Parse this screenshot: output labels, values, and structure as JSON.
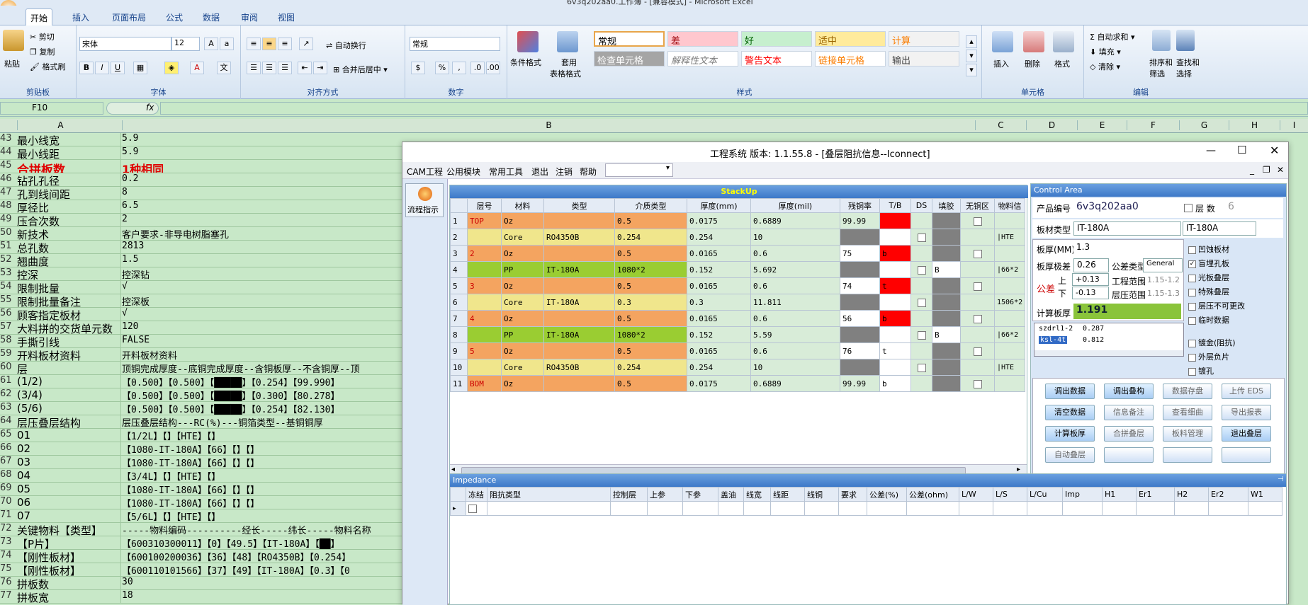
{
  "window_title": "6v3q202aa0.工作簿 - [兼容模式] - Microsoft Excel",
  "ribbon": {
    "tabs": [
      "开始",
      "插入",
      "页面布局",
      "公式",
      "数据",
      "审阅",
      "视图"
    ],
    "clipboard": {
      "paste": "粘贴",
      "cut": "剪切",
      "copy": "复制",
      "format_painter": "格式刷",
      "group": "剪贴板"
    },
    "font": {
      "name": "宋体",
      "size": "12",
      "group": "字体"
    },
    "alignment": {
      "wrap": "自动换行",
      "merge": "合并后居中",
      "group": "对齐方式"
    },
    "number": {
      "format": "常规",
      "group": "数字"
    },
    "styles": {
      "cond_format": "条件格式",
      "table_format_1": "套用",
      "table_format_2": "表格格式",
      "cells": [
        {
          "label": "常规",
          "bg": "#ffffff",
          "fg": "#000000"
        },
        {
          "label": "差",
          "bg": "#ffc7ce",
          "fg": "#9c0006"
        },
        {
          "label": "好",
          "bg": "#c6efce",
          "fg": "#006100"
        },
        {
          "label": "适中",
          "bg": "#ffeb9c",
          "fg": "#9c6500"
        },
        {
          "label": "计算",
          "bg": "#f2f2f2",
          "fg": "#fa7d00"
        },
        {
          "label": "检查单元格",
          "bg": "#a5a5a5",
          "fg": "#ffffff"
        },
        {
          "label": "解释性文本",
          "bg": "#ffffff",
          "fg": "#7f7f7f"
        },
        {
          "label": "警告文本",
          "bg": "#ffffff",
          "fg": "#ff0000"
        },
        {
          "label": "链接单元格",
          "bg": "#ffffff",
          "fg": "#fa7d00"
        },
        {
          "label": "输出",
          "bg": "#f2f2f2",
          "fg": "#3f3f3f"
        }
      ],
      "group": "样式"
    },
    "cells_group": {
      "insert": "插入",
      "delete": "删除",
      "format": "格式",
      "group": "单元格"
    },
    "editing": {
      "autosum": "自动求和",
      "fill": "填充",
      "clear": "清除",
      "sort_1": "排序和",
      "sort_2": "筛选",
      "find_1": "查找和",
      "find_2": "选择",
      "group": "编辑"
    }
  },
  "formula_bar": {
    "name_box": "F10",
    "fx": "fx",
    "value": ""
  },
  "columns": [
    "A",
    "B",
    "C",
    "D",
    "E",
    "F",
    "G",
    "H",
    "I"
  ],
  "rows": [
    {
      "n": "43",
      "a": "最小线宽",
      "b": "5.9"
    },
    {
      "n": "44",
      "a": "最小线距",
      "b": "5.9"
    },
    {
      "n": "45",
      "a": "合拼板数",
      "b": "1种相同",
      "red": true
    },
    {
      "n": "46",
      "a": "钻孔孔径",
      "b": "0.2"
    },
    {
      "n": "47",
      "a": "孔到线间距",
      "b": "8"
    },
    {
      "n": "48",
      "a": "厚径比",
      "b": "6.5"
    },
    {
      "n": "49",
      "a": "压合次数",
      "b": "2"
    },
    {
      "n": "50",
      "a": "新技术",
      "b": "客户要求-非导电树脂塞孔"
    },
    {
      "n": "51",
      "a": "总孔数",
      "b": "2813"
    },
    {
      "n": "52",
      "a": "翘曲度",
      "b": "1.5"
    },
    {
      "n": "53",
      "a": "控深",
      "b": "控深钻"
    },
    {
      "n": "54",
      "a": "限制批量",
      "b": "√"
    },
    {
      "n": "55",
      "a": "限制批量备注",
      "b": "控深板"
    },
    {
      "n": "56",
      "a": "顾客指定板材",
      "b": "√"
    },
    {
      "n": "57",
      "a": "大料拼的交货单元数",
      "b": "120"
    },
    {
      "n": "58",
      "a": "手撕引线",
      "b": "FALSE"
    },
    {
      "n": "59",
      "a": "开料板材资料",
      "b": "开料板材资料"
    },
    {
      "n": "60",
      "a": "层",
      "b": "顶铜完成厚度--底铜完成厚度--含铜板厚--不含铜厚--顶"
    },
    {
      "n": "61",
      "a": "(1/2)",
      "b": "【0.500】【0.500】【█████】【0.254】【99.990】"
    },
    {
      "n": "62",
      "a": "(3/4)",
      "b": "【0.500】【0.500】【█████】【0.300】【80.278】"
    },
    {
      "n": "63",
      "a": "(5/6)",
      "b": "【0.500】【0.500】【█████】【0.254】【82.130】"
    },
    {
      "n": "64",
      "a": "层压叠层结构",
      "b": "层压叠层结构---RC(%)---铜箔类型--基铜铜厚"
    },
    {
      "n": "65",
      "a": "01",
      "b": "【1/2L】【】【HTE】【】"
    },
    {
      "n": "66",
      "a": "02",
      "b": "【1080-IT-180A】【66】【】【】"
    },
    {
      "n": "67",
      "a": "03",
      "b": "【1080-IT-180A】【66】【】【】"
    },
    {
      "n": "68",
      "a": "04",
      "b": "【3/4L】【】【HTE】【】"
    },
    {
      "n": "69",
      "a": "05",
      "b": "【1080-IT-180A】【66】【】【】"
    },
    {
      "n": "70",
      "a": "06",
      "b": "【1080-IT-180A】【66】【】【】"
    },
    {
      "n": "71",
      "a": "07",
      "b": "【5/6L】【】【HTE】【】"
    },
    {
      "n": "72",
      "a": "关键物料【类型】",
      "b": "-----物料编码----------经长-----纬长-----物料名称"
    },
    {
      "n": "73",
      "a": "【P片】",
      "b": "【600310300011】【0】【49.5】【IT-180A】【██】"
    },
    {
      "n": "74",
      "a": "【刚性板材】",
      "b": "【600100200036】【36】【48】【RO4350B】【0.254】"
    },
    {
      "n": "75",
      "a": "【刚性板材】",
      "b": "【600110101566】【37】【49】【IT-180A】【0.3】【0"
    },
    {
      "n": "76",
      "a": "拼板数",
      "b": "30"
    },
    {
      "n": "77",
      "a": "拼板宽",
      "b": "18"
    }
  ],
  "app": {
    "title": "工程系统  版本: 1.1.55.8 - [叠层阻抗信息--Iconnect]",
    "menu": [
      "CAM工程",
      "公用模块",
      "常用工具",
      "退出",
      "注销",
      "帮助"
    ],
    "flow_label": "流程指示",
    "stackup": {
      "title": "StackUp",
      "headers": [
        "",
        "层号",
        "材料",
        "类型",
        "介质类型",
        "厚度(mm)",
        "厚度(mil)",
        "残铜率",
        "T/B",
        "DS",
        "填胶",
        "无铜区",
        "物料信"
      ],
      "rows": [
        {
          "i": "1",
          "layer": "TOP",
          "mat": "Oz",
          "type": "",
          "diel": "0.5",
          "mm": "0.0175",
          "mil": "0.6889",
          "res": "99.99",
          "tb": "",
          "fill": "",
          "mi": "",
          "cls": "cu"
        },
        {
          "i": "2",
          "layer": "",
          "mat": "Core",
          "type": "RO4350B",
          "diel": "0.254",
          "mm": "0.254",
          "mil": "10",
          "res": "",
          "tb": "",
          "fill": "",
          "mi": "|HTE",
          "cls": "core"
        },
        {
          "i": "3",
          "layer": "2",
          "mat": "Oz",
          "type": "",
          "diel": "0.5",
          "mm": "0.0165",
          "mil": "0.6",
          "res": "75",
          "tb": "b",
          "fill": "",
          "mi": "",
          "cls": "cu"
        },
        {
          "i": "4",
          "layer": "",
          "mat": "PP",
          "type": "IT-180A",
          "diel": "1080*2",
          "mm": "0.152",
          "mil": "5.692",
          "res": "",
          "tb": "",
          "fill": "B",
          "mi": "|66*2",
          "cls": "pp"
        },
        {
          "i": "5",
          "layer": "3",
          "mat": "Oz",
          "type": "",
          "diel": "0.5",
          "mm": "0.0165",
          "mil": "0.6",
          "res": "74",
          "tb": "t",
          "fill": "",
          "mi": "",
          "cls": "cu"
        },
        {
          "i": "6",
          "layer": "",
          "mat": "Core",
          "type": "IT-180A",
          "diel": "0.3",
          "mm": "0.3",
          "mil": "11.811",
          "res": "",
          "tb": "",
          "fill": "",
          "mi": "1506*2",
          "cls": "core"
        },
        {
          "i": "7",
          "layer": "4",
          "mat": "Oz",
          "type": "",
          "diel": "0.5",
          "mm": "0.0165",
          "mil": "0.6",
          "res": "56",
          "tb": "b",
          "fill": "",
          "mi": "",
          "cls": "cu"
        },
        {
          "i": "8",
          "layer": "",
          "mat": "PP",
          "type": "IT-180A",
          "diel": "1080*2",
          "mm": "0.152",
          "mil": "5.59",
          "res": "",
          "tb": "",
          "fill": "B",
          "mi": "|66*2",
          "cls": "pp"
        },
        {
          "i": "9",
          "layer": "5",
          "mat": "Oz",
          "type": "",
          "diel": "0.5",
          "mm": "0.0165",
          "mil": "0.6",
          "res": "76",
          "tb": "t",
          "fill": "",
          "mi": "",
          "cls": "cu"
        },
        {
          "i": "10",
          "layer": "",
          "mat": "Core",
          "type": "RO4350B",
          "diel": "0.254",
          "mm": "0.254",
          "mil": "10",
          "res": "",
          "tb": "",
          "fill": "",
          "mi": "|HTE",
          "cls": "core"
        },
        {
          "i": "11",
          "layer": "BOM",
          "mat": "Oz",
          "type": "",
          "diel": "0.5",
          "mm": "0.0175",
          "mil": "0.6889",
          "res": "99.99",
          "tb": "b",
          "fill": "",
          "mi": "",
          "cls": "cu"
        }
      ]
    },
    "control": {
      "title": "Control Area",
      "product_label": "产品编号",
      "product": "6v3q202aa0",
      "layers_label": "层  数",
      "layers": "6",
      "material_label": "板材类型",
      "material_1": "IT-180A",
      "material_2": "IT-180A",
      "thickness_label": "板厚(MM)",
      "thickness": "1.3",
      "tol_label": "板厚极差",
      "tol": "0.26",
      "tol_type_label": "公差类型",
      "tol_type": "General",
      "gongcha": "公差",
      "upper": "上",
      "lower": "下",
      "upper_val": "+0.13",
      "lower_val": "-0.13",
      "eng_range_label": "工程范围",
      "eng_range": "1.15-1.2",
      "press_range_label": "层压范围",
      "press_range": "1.15-1.3",
      "calc_label": "计算板厚",
      "calc": "1.191",
      "list": [
        {
          "k": "szdrl1-2",
          "v": "0.287"
        },
        {
          "k": "ksl-4t",
          "v": "0.812"
        }
      ],
      "checks": [
        {
          "label": "凹蚀板材",
          "on": false
        },
        {
          "label": "盲埋孔板",
          "on": true
        },
        {
          "label": "光板叠层",
          "on": false
        },
        {
          "label": "特殊叠层",
          "on": false
        },
        {
          "label": "层压不可更改",
          "on": false
        },
        {
          "label": "临时数据",
          "on": false
        },
        {
          "label": "镀金(阻抗)",
          "on": false
        },
        {
          "label": "外层负片",
          "on": false
        },
        {
          "label": "镀孔",
          "on": false
        }
      ],
      "buttons": [
        {
          "label": "调出数据",
          "on": true
        },
        {
          "label": "调出叠构",
          "on": true
        },
        {
          "label": "数据存盘",
          "on": false
        },
        {
          "label": "上传 EDS",
          "on": false
        },
        {
          "label": "清空数据",
          "on": true
        },
        {
          "label": "信息备注",
          "on": false
        },
        {
          "label": "查看细曲",
          "on": false
        },
        {
          "label": "导出报表",
          "on": false
        },
        {
          "label": "计算板厚",
          "on": true
        },
        {
          "label": "合拼叠层",
          "on": false
        },
        {
          "label": "板料管理",
          "on": false
        },
        {
          "label": "退出叠层",
          "on": true
        },
        {
          "label": "自动叠层",
          "on": false
        },
        {
          "label": "",
          "on": false
        },
        {
          "label": "",
          "on": false
        },
        {
          "label": "",
          "on": false
        }
      ]
    },
    "impedance": {
      "title": "Impedance",
      "headers": [
        "",
        "冻结",
        "阻抗类型",
        "控制层",
        "上参",
        "下参",
        "盖油",
        "线宽",
        "线距",
        "线铜",
        "要求",
        "公差(%)",
        "公差(ohm)",
        "L/W",
        "L/S",
        "L/Cu",
        "Imp",
        "H1",
        "Er1",
        "H2",
        "Er2",
        "W1"
      ]
    }
  }
}
